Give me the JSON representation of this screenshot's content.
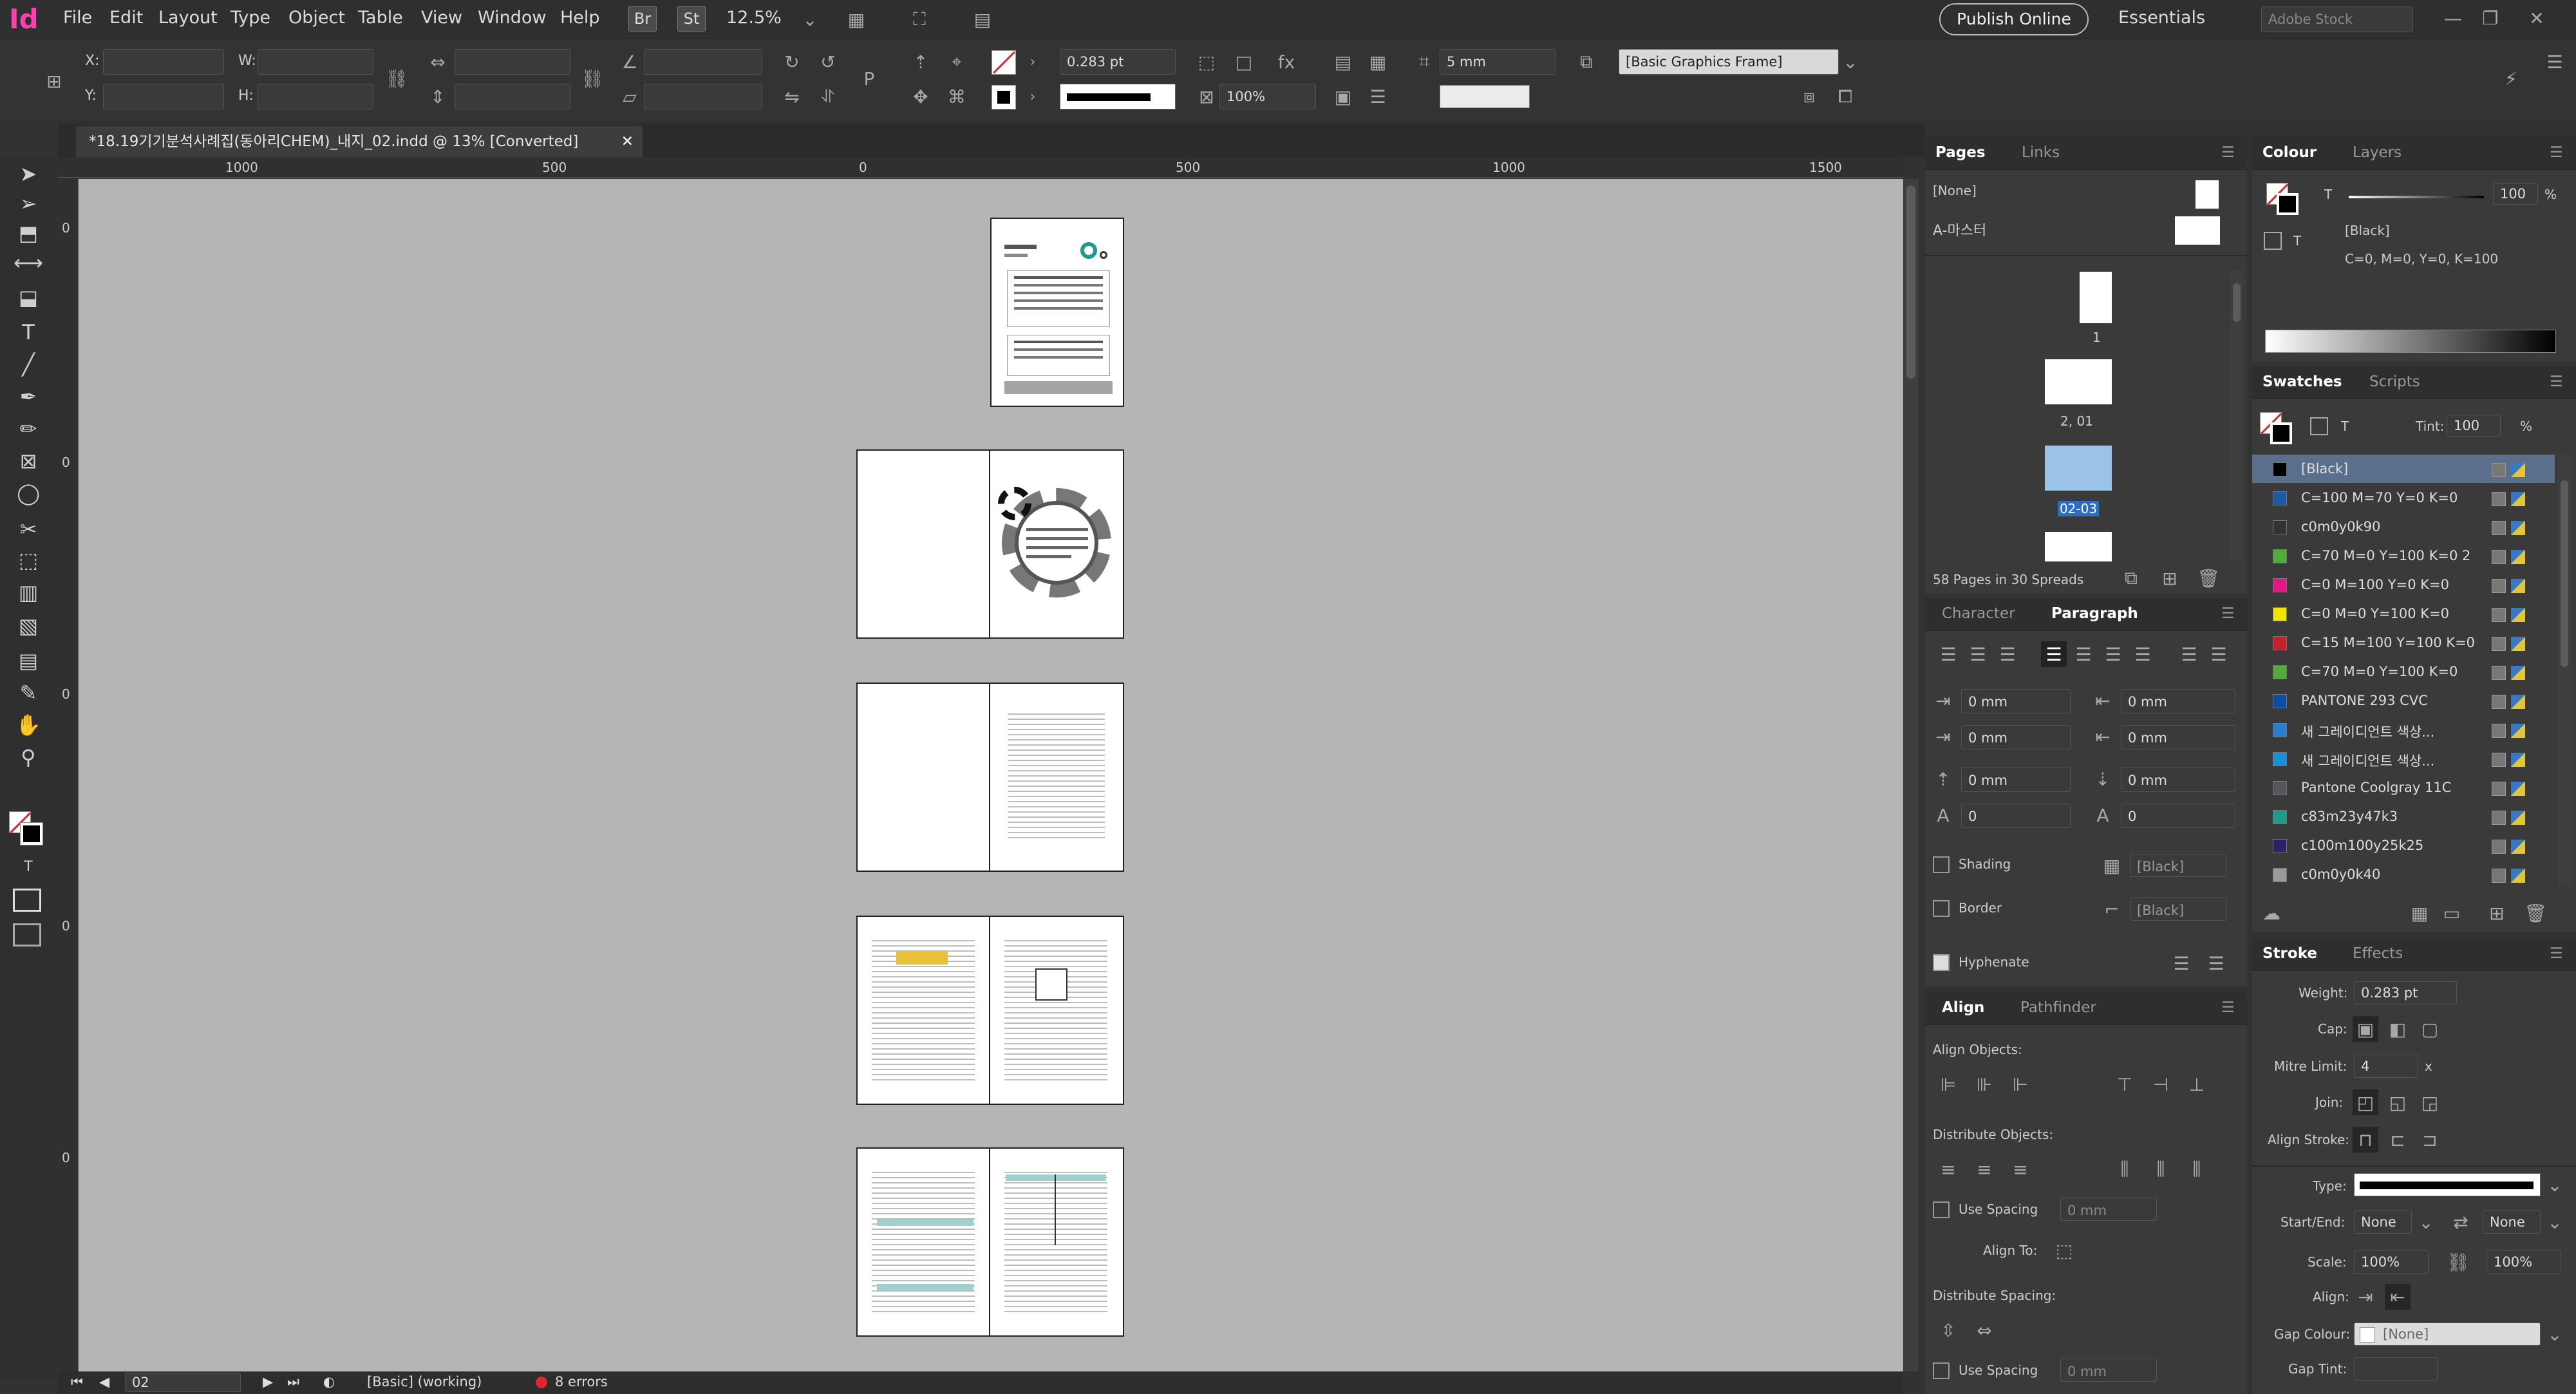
{
  "menubar": {
    "app_logo": "Id",
    "items": [
      "File",
      "Edit",
      "Layout",
      "Type",
      "Object",
      "Table",
      "View",
      "Window",
      "Help"
    ],
    "bridge": "Br",
    "stock": "St",
    "zoom": "12.5%",
    "publish": "Publish Online",
    "workspace": "Essentials",
    "search_placeholder": "Adobe Stock"
  },
  "control": {
    "x_label": "X:",
    "y_label": "Y:",
    "w_label": "W:",
    "h_label": "H:",
    "stroke_weight": "0.283 pt",
    "scale_pct": "100%",
    "gap": "5 mm",
    "frame_style": "[Basic Graphics Frame]"
  },
  "document": {
    "tab_title": "*18.19기기분석사례집(동아리CHEM)_내지_02.indd @ 13% [Converted]",
    "ruler_ticks": [
      "1000",
      "500",
      "0",
      "500",
      "1000",
      "1500"
    ],
    "vruler_ticks": [
      "0",
      "0",
      "0",
      "0",
      "0"
    ]
  },
  "status": {
    "page": "02",
    "style": "[Basic] (working)",
    "errors": "8 errors"
  },
  "pages_panel": {
    "tabs": [
      "Pages",
      "Links"
    ],
    "none": "[None]",
    "master": "A-마스터",
    "labels": [
      "1",
      "2, 01",
      "02-03"
    ],
    "summary": "58 Pages in 30 Spreads"
  },
  "colour_panel": {
    "tabs": [
      "Colour",
      "Layers"
    ],
    "tint_label": "T",
    "tint_value": "100",
    "pct": "%",
    "swatch_name": "[Black]",
    "cmyk": "C=0, M=0, Y=0, K=100"
  },
  "swatches_panel": {
    "tabs": [
      "Swatches",
      "Scripts"
    ],
    "tint_label": "Tint:",
    "tint_value": "100",
    "pct": "%",
    "items": [
      {
        "name": "[Black]",
        "color": "#000000"
      },
      {
        "name": "C=100 M=70 Y=0 K=0",
        "color": "#1b5aa6"
      },
      {
        "name": "c0m0y0k90",
        "color": "#333333"
      },
      {
        "name": "C=70 M=0 Y=100 K=0 2",
        "color": "#4fae3a"
      },
      {
        "name": "C=0 M=100 Y=0 K=0",
        "color": "#e0178a"
      },
      {
        "name": "C=0 M=0 Y=100 K=0",
        "color": "#f2e500"
      },
      {
        "name": "C=15 M=100 Y=100 K=0",
        "color": "#c8202a"
      },
      {
        "name": "C=70 M=0 Y=100 K=0",
        "color": "#4fae3a"
      },
      {
        "name": "PANTONE 293 CVC",
        "color": "#0a4ea8"
      },
      {
        "name": "새 그레이디언트 색상...",
        "color": "#2a7fd0"
      },
      {
        "name": "새 그레이디언트 색상...",
        "color": "#1a8fd8"
      },
      {
        "name": "Pantone Coolgray 11C",
        "color": "#55565a"
      },
      {
        "name": "c83m23y47k3",
        "color": "#1e9b8d"
      },
      {
        "name": "c100m100y25k25",
        "color": "#2a2466"
      },
      {
        "name": "c0m0y0k40",
        "color": "#9a9a9a"
      }
    ]
  },
  "paragraph_panel": {
    "tabs": [
      "Character",
      "Paragraph"
    ],
    "indents": [
      "0 mm",
      "0 mm",
      "0 mm",
      "0 mm",
      "0 mm",
      "0 mm",
      "0",
      "0"
    ],
    "shading": "Shading",
    "border": "Border",
    "black": "[Black]",
    "hyphenate": "Hyphenate"
  },
  "align_panel": {
    "tabs": [
      "Align",
      "Pathfinder"
    ],
    "align_objects": "Align Objects:",
    "distribute_objects": "Distribute Objects:",
    "use_spacing": "Use Spacing",
    "spacing_value": "0 mm",
    "align_to": "Align To:",
    "distribute_spacing": "Distribute Spacing:"
  },
  "stroke_panel": {
    "tabs": [
      "Stroke",
      "Effects"
    ],
    "weight_label": "Weight:",
    "weight": "0.283 pt",
    "cap_label": "Cap:",
    "mitre_label": "Mitre Limit:",
    "mitre": "4",
    "x": "x",
    "join_label": "Join:",
    "align_stroke_label": "Align Stroke:",
    "type_label": "Type:",
    "startend_label": "Start/End:",
    "start": "None",
    "end": "None",
    "scale_label": "Scale:",
    "scale1": "100%",
    "scale2": "100%",
    "align_label": "Align:",
    "gap_colour_label": "Gap Colour:",
    "gap_colour": "[None]",
    "gap_tint_label": "Gap Tint:"
  }
}
